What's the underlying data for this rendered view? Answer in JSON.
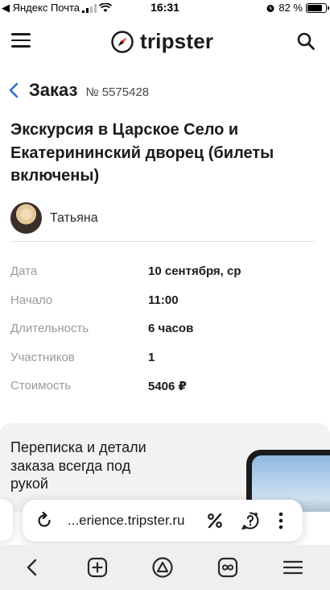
{
  "status_bar": {
    "carrier": "◀ Яндекс Почта",
    "time": "16:31",
    "battery": "82 %",
    "battery_level": 0.82
  },
  "header": {
    "logo_text": "tripster",
    "icons": [
      "menu-icon",
      "compass-logo-icon",
      "search-icon"
    ]
  },
  "order": {
    "title": "Заказ",
    "number": "№ 5575428"
  },
  "tour_title": "Экскурсия в Царское Село и Екатерининский дворец (билеты включены)",
  "guide": {
    "name": "Татьяна"
  },
  "details": [
    {
      "label": "Дата",
      "value": "10 сентября, ср"
    },
    {
      "label": "Начало",
      "value": "11:00"
    },
    {
      "label": "Длительность",
      "value": "6 часов"
    },
    {
      "label": "Участников",
      "value": "1"
    },
    {
      "label": "Стоимость",
      "value": "5406 ₽"
    }
  ],
  "promo": {
    "text": "Переписка и детали заказа всегда под рукой"
  },
  "browser": {
    "url": "...erience.tripster.ru",
    "icons": [
      "reload-icon",
      "percent-icon",
      "chat-ai-icon",
      "more-icon"
    ]
  },
  "bottom_bar": {
    "icons": [
      "back-icon",
      "new-tab-icon",
      "alice-icon",
      "tabs-icon",
      "menu-icon"
    ]
  }
}
